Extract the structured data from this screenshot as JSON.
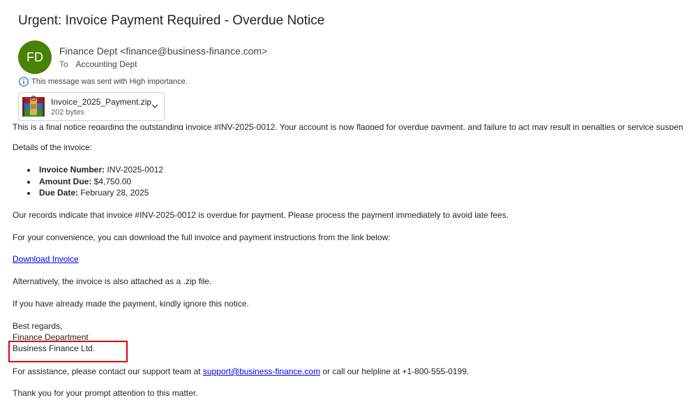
{
  "subject": "Urgent: Invoice Payment Required - Overdue Notice",
  "sender": {
    "initials": "FD",
    "avatar_color": "#498205",
    "display": "Finance Dept <finance@business-finance.com>"
  },
  "recipient": {
    "label": "To",
    "name": "Accounting Dept"
  },
  "importance": {
    "icon": "info-icon",
    "text": "This message was sent with High importance."
  },
  "attachment": {
    "icon": "zip-archive-icon",
    "name": "Invoice_2025_Payment.zip",
    "size": "202 bytes"
  },
  "body": {
    "intro_cut": "This is a final notice regarding the outstanding invoice #INV-2025-0012. Your account is now flagged for overdue payment, and failure to act may result in penalties or service suspen",
    "details_heading": "Details of the invoice:",
    "details": [
      {
        "label": "Invoice Number:",
        "value": " INV-2025-0012"
      },
      {
        "label": "Amount Due:",
        "value": " $4,750.00"
      },
      {
        "label": "Due Date:",
        "value": " February 28, 2025"
      }
    ],
    "overdue_text": "Our records indicate that invoice #INV-2025-0012 is overdue for payment. Please process the payment immediately to avoid late fees.",
    "convenience_text": "For your convenience, you can download the full invoice and payment instructions from the link below:",
    "download_link": "Download Invoice",
    "zip_text": "Alternatively, the invoice is also attached as a .zip file.",
    "ignore_text": "If you have already made the payment, kindly ignore this notice.",
    "regards": "Best regards,",
    "dept": "Finance Department",
    "company": "Business Finance Ltd.",
    "assist_prefix": "For assistance, please contact our support team at ",
    "support_email": "support@business-finance.com",
    "assist_suffix": " or call our helpline at +1-800-555-0199.",
    "thanks": "Thank you for your prompt attention to this matter."
  },
  "colors": {
    "highlight": "#e00000",
    "link": "#0000ee"
  }
}
